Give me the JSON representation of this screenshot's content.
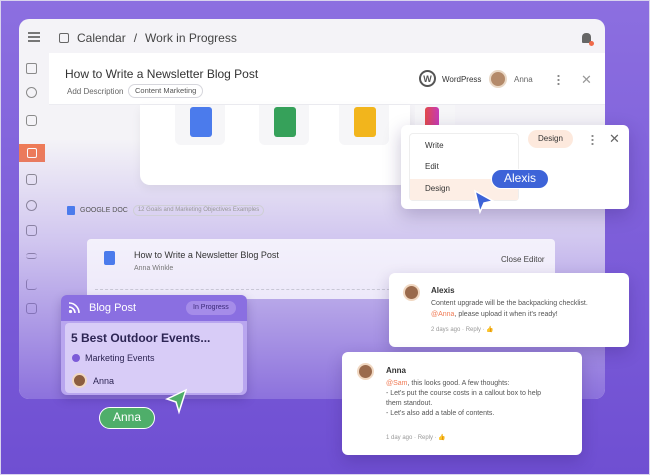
{
  "topbar": {
    "breadcrumb_root": "Calendar",
    "breadcrumb_sep": "/",
    "breadcrumb_current": "Work in Progress"
  },
  "doc": {
    "title": "How to Write a Newsletter Blog Post",
    "add_description": "Add Description",
    "tag": "Content Marketing",
    "integration": "WordPress",
    "assignee": "Anna"
  },
  "google_doc": {
    "label": "GOOGLE DOC",
    "pill": "12 Goals and Marketing Objectives Examples"
  },
  "editor": {
    "title": "How to Write a Newsletter Blog Post",
    "author": "Anna Winkle",
    "close_label": "Close Editor"
  },
  "menu": {
    "items": [
      "Write",
      "Edit",
      "Design"
    ],
    "selected": "Design",
    "badge": "Design"
  },
  "cursors": {
    "alexis": "Alexis",
    "anna": "Anna"
  },
  "comments": [
    {
      "name": "Alexis",
      "line1": "Content upgrade will be the backpacking checklist.",
      "mention": "@Anna",
      "line2_rest": ", please upload it when it's ready!",
      "meta": "2 days ago · Reply ·"
    },
    {
      "name": "Anna",
      "mention": "@Sam",
      "line1_rest": ", this looks good. A few thoughts:",
      "line2": "- Let's put the course costs in a callout box to help",
      "line3": "them standout.",
      "line4": "- Let's also add a table of contents.",
      "meta": "1 day ago · Reply ·"
    }
  ],
  "blog_card": {
    "type": "Blog Post",
    "status": "In Progress",
    "heading": "5 Best Outdoor Events...",
    "category": "Marketing Events",
    "person": "Anna"
  },
  "colors": {
    "background": "#7a5bd8",
    "accent_orange": "#f07b55",
    "alexis_blue": "#3d63d8",
    "anna_green": "#4fae6a",
    "card_purple": "#8a6fe1"
  },
  "icons": [
    "menu-icon",
    "calendar-icon",
    "bell-icon",
    "wordpress-icon",
    "docs-icon",
    "sheets-icon",
    "slides-icon",
    "rss-icon",
    "kebab-icon",
    "close-icon"
  ]
}
